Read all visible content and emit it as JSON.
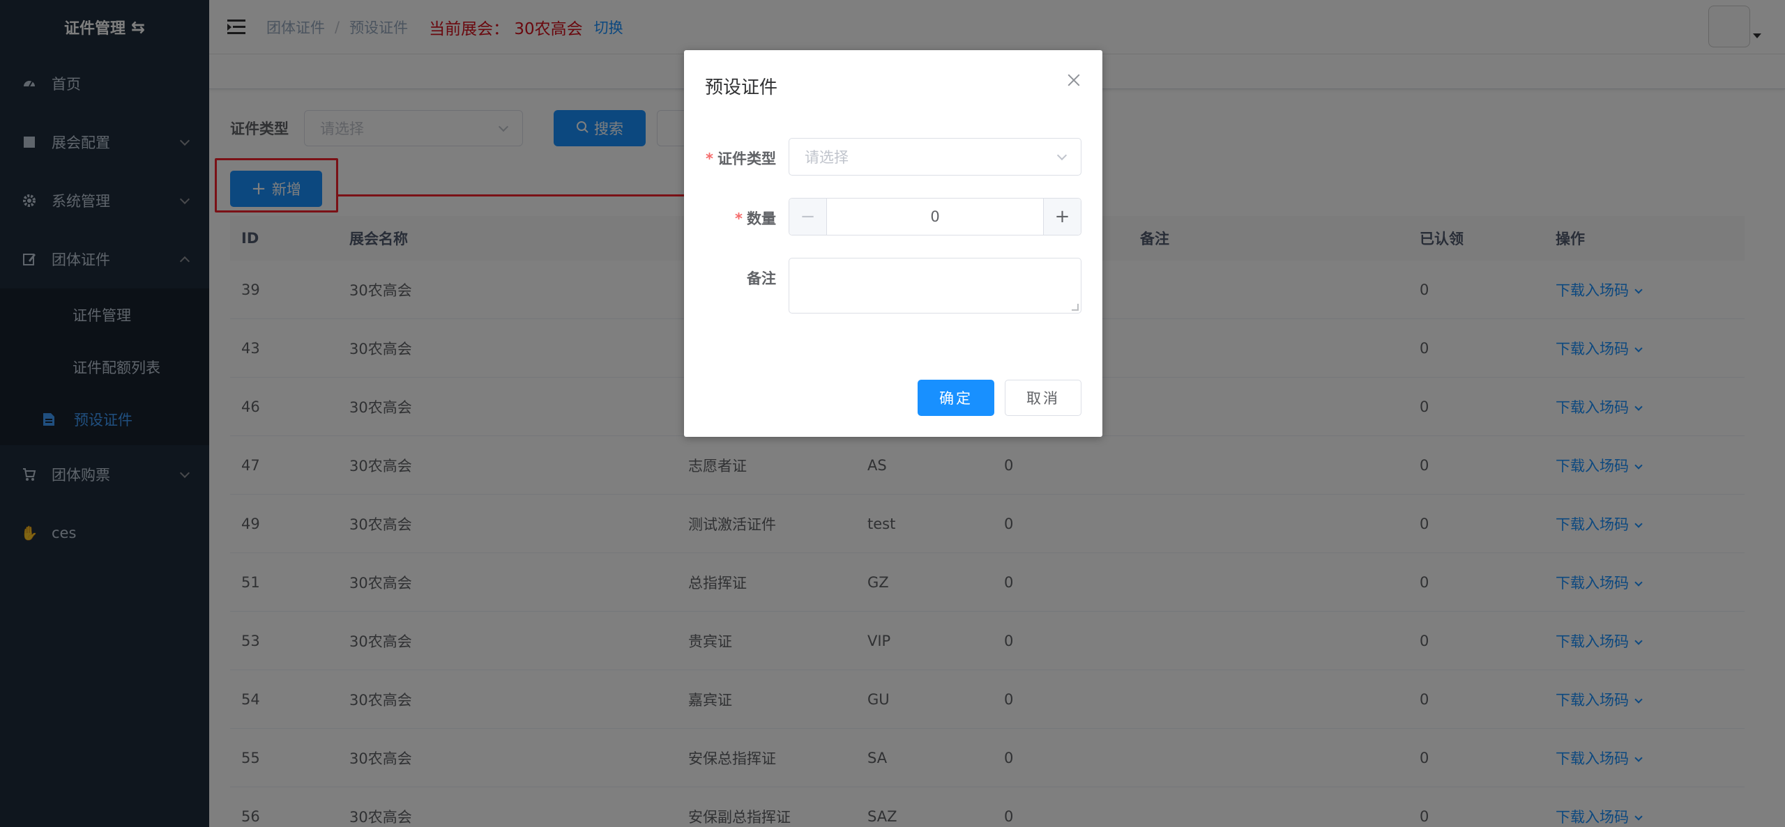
{
  "sidebar": {
    "title": "证件管理",
    "items": [
      {
        "label": "首页",
        "icon": "dashboard-icon"
      },
      {
        "label": "展会配置",
        "icon": "clapperboard-icon"
      },
      {
        "label": "系统管理",
        "icon": "gear-icon"
      },
      {
        "label": "团体证件",
        "icon": "edit-icon"
      }
    ],
    "sub_items": [
      {
        "label": "证件管理"
      },
      {
        "label": "证件配额列表"
      },
      {
        "label": "预设证件",
        "icon": "document-icon"
      }
    ],
    "items_after": [
      {
        "label": "团体购票",
        "icon": "cart-icon"
      },
      {
        "label": "ces",
        "icon": "hand-icon"
      }
    ]
  },
  "navbar": {
    "breadcrumbs": [
      "团体证件",
      "预设证件"
    ],
    "breadcrumb_sep": "/",
    "current_expo": "当前展会：  30农高会",
    "switch_label": "切换"
  },
  "filter": {
    "type_label": "证件类型",
    "type_placeholder": "请选择",
    "search_label": "搜索"
  },
  "toolbar": {
    "add_label": "新增"
  },
  "table": {
    "headers": {
      "id": "ID",
      "name": "展会名称",
      "remark": "备注",
      "auth": "已认领",
      "op": "操作"
    },
    "op_label": "下载入场码",
    "rows": [
      {
        "id": "39",
        "name": "30农高会",
        "type": "",
        "code": "",
        "count": "",
        "auth": "0"
      },
      {
        "id": "43",
        "name": "30农高会",
        "type": "",
        "code": "",
        "count": "",
        "auth": "0"
      },
      {
        "id": "46",
        "name": "30农高会",
        "type": "",
        "code": "",
        "count": "",
        "auth": "0"
      },
      {
        "id": "47",
        "name": "30农高会",
        "type": "志愿者证",
        "code": "AS",
        "count": "0",
        "auth": "0"
      },
      {
        "id": "49",
        "name": "30农高会",
        "type": "测试激活证件",
        "code": "test",
        "count": "0",
        "auth": "0"
      },
      {
        "id": "51",
        "name": "30农高会",
        "type": "总指挥证",
        "code": "GZ",
        "count": "0",
        "auth": "0"
      },
      {
        "id": "53",
        "name": "30农高会",
        "type": "贵宾证",
        "code": "VIP",
        "count": "0",
        "auth": "0"
      },
      {
        "id": "54",
        "name": "30农高会",
        "type": "嘉宾证",
        "code": "GU",
        "count": "0",
        "auth": "0"
      },
      {
        "id": "55",
        "name": "30农高会",
        "type": "安保总指挥证",
        "code": "SA",
        "count": "0",
        "auth": "0"
      },
      {
        "id": "56",
        "name": "30农高会",
        "type": "安保副总指挥证",
        "code": "SAZ",
        "count": "0",
        "auth": "0"
      }
    ]
  },
  "dialog": {
    "title": "预设证件",
    "required_mark": "*",
    "type_label": "证件类型",
    "type_placeholder": "请选择",
    "qty_label": "数量",
    "qty_value": "0",
    "remark_label": "备注",
    "ok_label": "确定",
    "cancel_label": "取消"
  },
  "colors": {
    "sidebar_bg": "#1f2d3d",
    "primary": "#1890ff",
    "highlight": "#f5222d",
    "expo_red": "#d4111d"
  }
}
